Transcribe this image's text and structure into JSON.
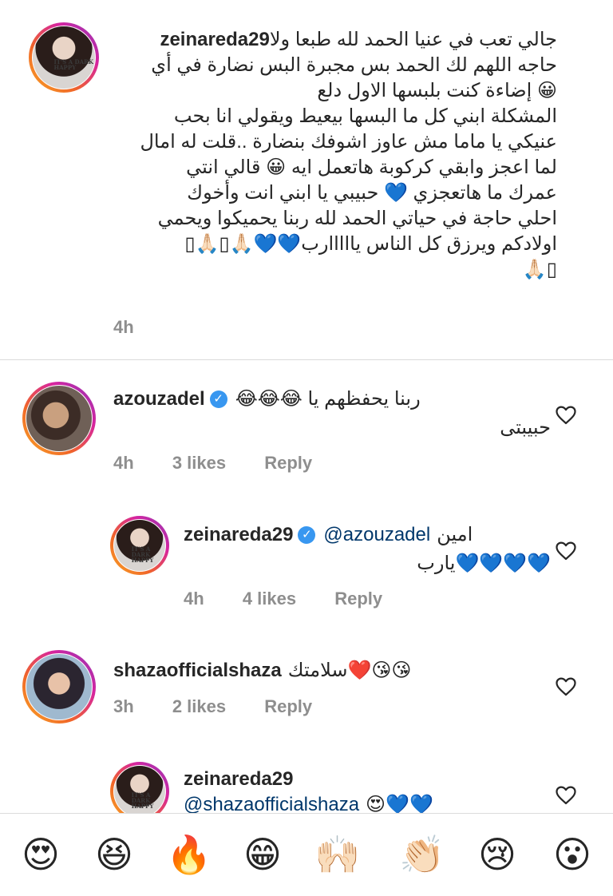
{
  "comments": [
    {
      "username": "zeinareda29",
      "verified": false,
      "lines": [
        "جالي تعب في عنيا الحمد لله طبعا ولا",
        "حاجه اللهم لك الحمد بس مجبرة البس نضارة في أي",
        "😀 إضاءة كنت بلبسها الاول دلع",
        "المشكلة ابني كل ما البسها بيعيط ويقولي انا بحب",
        "عنيكي يا ماما مش عاوز اشوفك بنضارة ..قلت له امال",
        "لما اعجز وابقي كركوبة هاتعمل ايه 😀 قالي انتي",
        "عمرك ما هاتعجزي 💙 حبيبي يا ابني انت وأخوك",
        "احلي حاجة في حياتي الحمد لله ربنا يحميكوا ويحمي",
        "اولادكم ويرزق كل الناس يااااارب💙💙🙏🏻▯🙏🏻▯",
        "🙏🏻▯"
      ],
      "time": "4h"
    },
    {
      "username": "azouzadel",
      "verified": true,
      "text_line1": "ربنا يحفظهم يا 😂😂😂",
      "text_line2": "حبيبتى",
      "time": "4h",
      "likes": "3 likes",
      "reply": "Reply"
    },
    {
      "username": "zeinareda29",
      "verified": true,
      "mention": "@azouzadel",
      "text_line1": "امين",
      "text_line2": "💙💙💙💙يارب",
      "time": "4h",
      "likes": "4 likes",
      "reply": "Reply"
    },
    {
      "username": "shazaofficialshaza",
      "verified": false,
      "text_line1": "😘😘❤️سلامتك",
      "time": "3h",
      "likes": "2 likes",
      "reply": "Reply"
    },
    {
      "username": "zeinareda29",
      "verified": false,
      "mention": "@shazaofficialshaza",
      "text_line2": "😍💙💙"
    }
  ],
  "avatar_text": "IT'S A DARK HAPPY",
  "emoji_bar": [
    "😍",
    "😆",
    "🔥",
    "😁",
    "🙌🏻",
    "👏🏻",
    "😢",
    "😮"
  ],
  "icons": {
    "heart": "heart-outline-icon",
    "verified": "verified-badge-icon"
  },
  "colors": {
    "text": "#262626",
    "meta": "#8e8e8e",
    "mention": "#00376b",
    "verified": "#3897f0",
    "divider": "#dbdbdb"
  }
}
